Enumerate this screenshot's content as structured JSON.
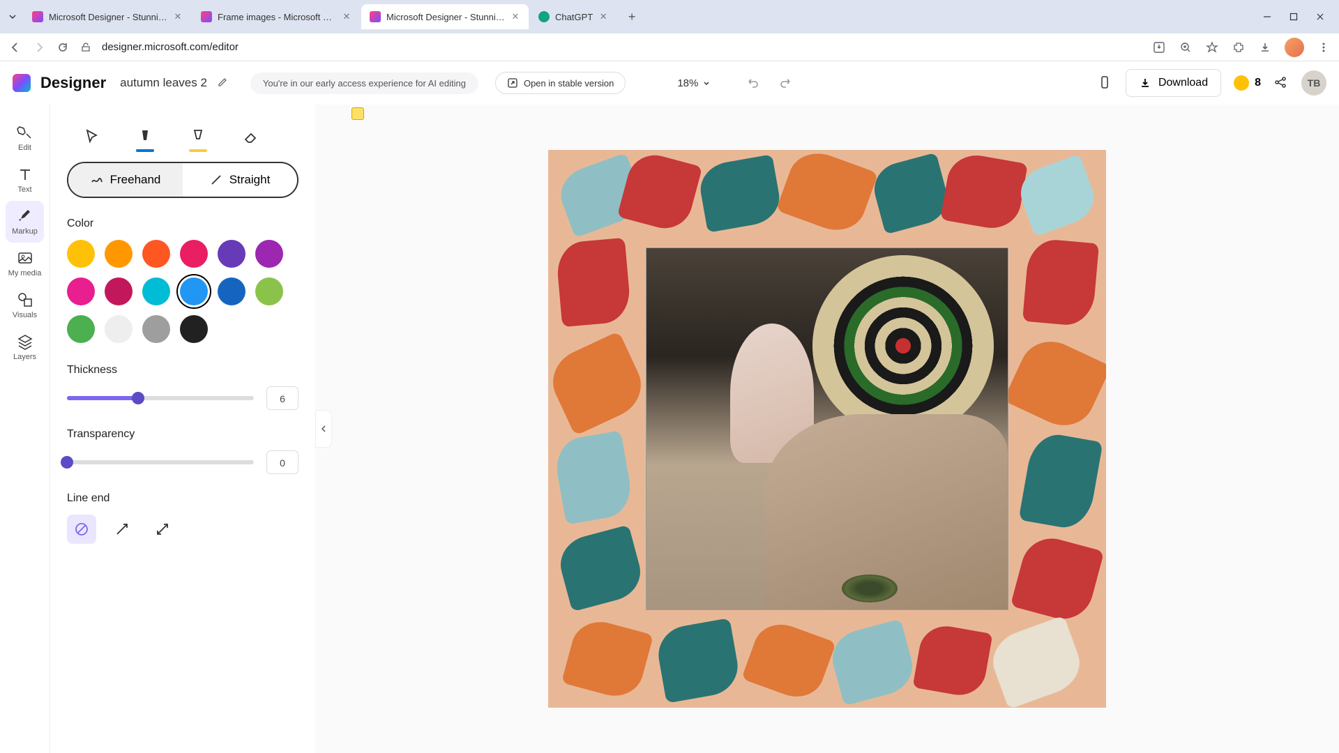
{
  "browser": {
    "tabs": [
      {
        "title": "Microsoft Designer - Stunning",
        "icon_color": "linear-gradient(135deg,#ff4081,#7c4dff)"
      },
      {
        "title": "Frame images - Microsoft Des",
        "icon_color": "linear-gradient(135deg,#ff4081,#7c4dff)"
      },
      {
        "title": "Microsoft Designer - Stunning",
        "icon_color": "linear-gradient(135deg,#ff4081,#7c4dff)",
        "active": true
      },
      {
        "title": "ChatGPT",
        "icon_color": "#10a37f"
      }
    ],
    "url": "designer.microsoft.com/editor"
  },
  "header": {
    "app_name": "Designer",
    "doc_name": "autumn leaves 2",
    "ea_notice": "You're in our early access experience for AI editing",
    "stable_btn": "Open in stable version",
    "zoom": "18%",
    "download": "Download",
    "credits": "8",
    "avatar": "TB"
  },
  "left_rail": {
    "items": [
      "Edit",
      "Text",
      "Markup",
      "My media",
      "Visuals",
      "Layers"
    ],
    "active": "Markup"
  },
  "panel": {
    "tools": [
      "select",
      "marker",
      "highlighter",
      "eraser"
    ],
    "active_tool": "marker",
    "mode": {
      "freehand": "Freehand",
      "straight": "Straight",
      "active": "freehand"
    },
    "color_label": "Color",
    "colors": [
      "#ffc107",
      "#ff9800",
      "#ff5722",
      "#e91e63",
      "#673ab7",
      "#9c27b0",
      "#e91e8f",
      "#c2185b",
      "#00bcd4",
      "#2196f3",
      "#1565c0",
      "#8bc34a",
      "#4caf50",
      "#eeeeee",
      "#9e9e9e",
      "#212121"
    ],
    "selected_color_index": 9,
    "thickness_label": "Thickness",
    "thickness_value": "6",
    "thickness_percent": 38,
    "transparency_label": "Transparency",
    "transparency_value": "0",
    "transparency_percent": 0,
    "lineend_label": "Line end",
    "lineend_options": [
      "none",
      "arrow",
      "double-arrow"
    ],
    "lineend_active": "none"
  }
}
